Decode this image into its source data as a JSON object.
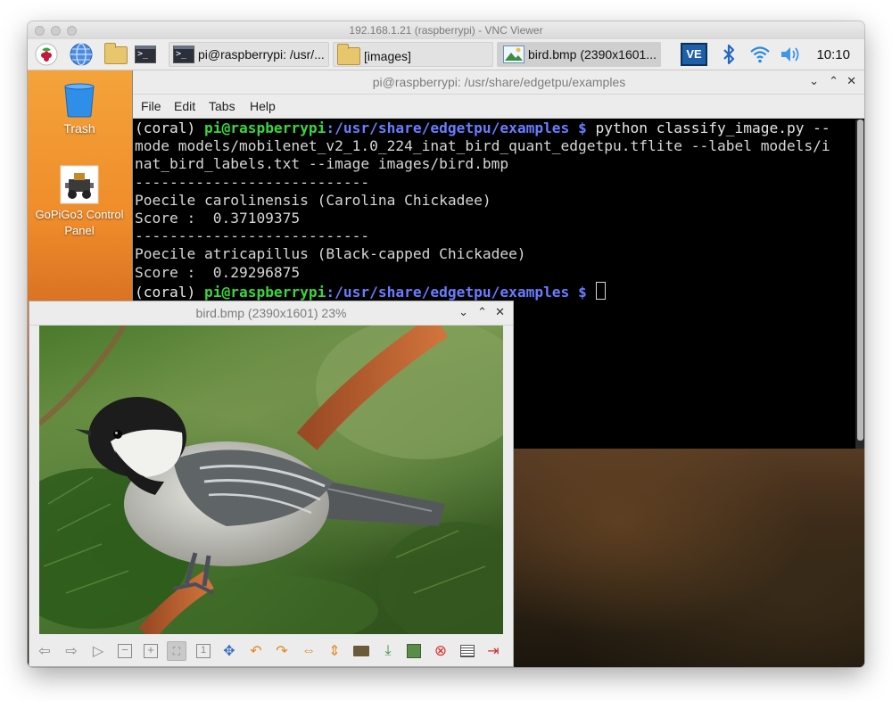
{
  "vnc": {
    "title": "192.168.1.21 (raspberrypi) - VNC Viewer"
  },
  "taskbar": {
    "tasks": [
      {
        "label": "pi@raspberrypi: /usr/...",
        "icon": "terminal-icon"
      },
      {
        "label": "[images]",
        "icon": "folder-icon"
      },
      {
        "label": "bird.bmp (2390x1601...",
        "icon": "image-icon"
      }
    ],
    "tray": {
      "vnc_label": "VE",
      "clock": "10:10"
    }
  },
  "desktop": {
    "icons": [
      {
        "label": "Trash",
        "icon": "trash-icon"
      },
      {
        "label": "GoPiGo3 Control Panel",
        "icon": "robot-icon"
      }
    ]
  },
  "terminal": {
    "title": "pi@raspberrypi: /usr/share/edgetpu/examples",
    "menu": [
      "File",
      "Edit",
      "Tabs",
      "Help"
    ],
    "prompt_env": "(coral) ",
    "prompt_user": "pi@raspberrypi",
    "prompt_path": ":/usr/share/edgetpu/examples $",
    "command_line1": " python classify_image.py --",
    "command_line2": "mode models/mobilenet_v2_1.0_224_inat_bird_quant_edgetpu.tflite --label models/i",
    "command_line3": "nat_bird_labels.txt --image images/bird.bmp",
    "separator": "---------------------------",
    "results": [
      {
        "name": "Poecile carolinensis (Carolina Chickadee)",
        "score": "Score :  0.37109375"
      },
      {
        "name": "Poecile atricapillus (Black-capped Chickadee)",
        "score": "Score :  0.29296875"
      }
    ]
  },
  "viewer": {
    "title": "bird.bmp (2390x1601) 23%"
  },
  "colors": {
    "prompt_user": "#39d63c",
    "prompt_path": "#6a7cff",
    "vnc_tray": "#1f5fa8"
  }
}
